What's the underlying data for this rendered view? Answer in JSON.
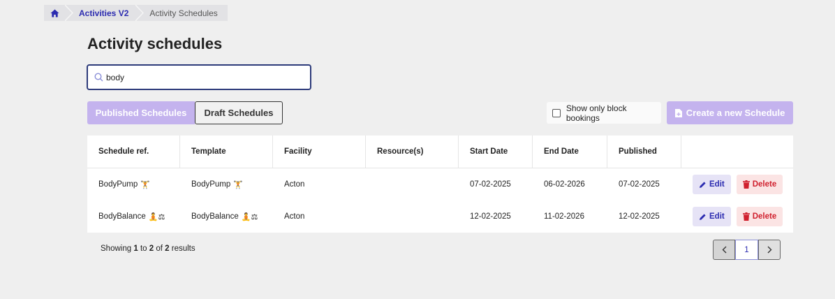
{
  "breadcrumb": {
    "home_icon": "home-icon",
    "parent": "Activities V2",
    "current": "Activity Schedules"
  },
  "page_title": "Activity schedules",
  "search": {
    "value": "body",
    "placeholder": ""
  },
  "tabs": {
    "published": "Published Schedules",
    "draft": "Draft Schedules"
  },
  "block_bookings_label": "Show only block bookings",
  "create_button": "Create a new Schedule",
  "table": {
    "headers": [
      "Schedule ref.",
      "Template",
      "Facility",
      "Resource(s)",
      "Start Date",
      "End Date",
      "Published",
      ""
    ],
    "rows": [
      {
        "ref": "BodyPump",
        "ref_emoji": "🏋",
        "template": "BodyPump",
        "template_emoji": "🏋",
        "facility": "Acton",
        "resources": "",
        "start": "07-02-2025",
        "end": "06-02-2026",
        "published": "07-02-2025"
      },
      {
        "ref": "BodyBalance",
        "ref_emoji": "🧘⚖",
        "template": "BodyBalance",
        "template_emoji": "🧘⚖",
        "facility": "Acton",
        "resources": "",
        "start": "12-02-2025",
        "end": "11-02-2026",
        "published": "12-02-2025"
      }
    ],
    "edit_label": "Edit",
    "delete_label": "Delete"
  },
  "results": {
    "prefix": "Showing",
    "from": "1",
    "to_word": "to",
    "to": "2",
    "of_word": "of",
    "total": "2",
    "suffix": "results"
  },
  "pager": {
    "current_page": "1"
  },
  "colors": {
    "accent": "#2b2bb0",
    "primary_disabled": "#c4b3ee",
    "danger": "#d0202e",
    "background": "#efefef"
  }
}
